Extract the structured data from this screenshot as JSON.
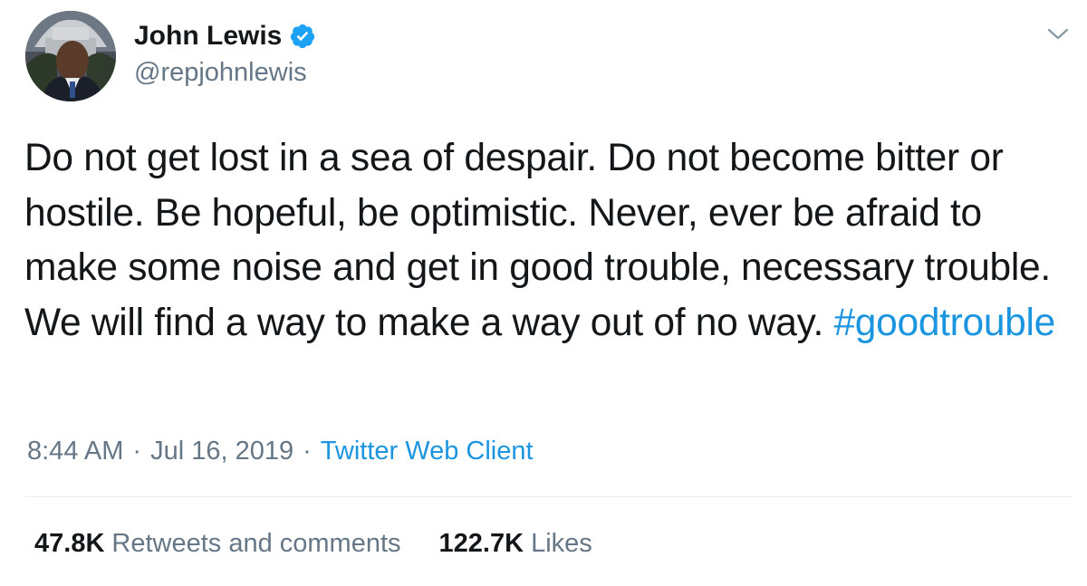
{
  "author": {
    "display_name": "John Lewis",
    "handle": "@repjohnlewis",
    "verified": true
  },
  "tweet": {
    "text": "Do not get lost in a sea of despair. Do not become bitter or hostile. Be hopeful, be optimistic. Never, ever be afraid to make some noise and get in good trouble, necessary trouble. We will find a way to make a way out of no way.",
    "hashtag": "#goodtrouble",
    "time": "8:44 AM",
    "date": "Jul 16, 2019",
    "separator": "·",
    "source": "Twitter Web Client"
  },
  "stats": {
    "retweets_count": "47.8K",
    "retweets_label": "Retweets and comments",
    "likes_count": "122.7K",
    "likes_label": "Likes"
  },
  "icons": {
    "verified": "verified-badge-icon",
    "menu": "chevron-down-icon"
  },
  "colors": {
    "text": "#14171a",
    "secondary": "#657786",
    "link": "#1b95e0",
    "verified": "#1da1f2",
    "divider": "#e6ecf0"
  }
}
